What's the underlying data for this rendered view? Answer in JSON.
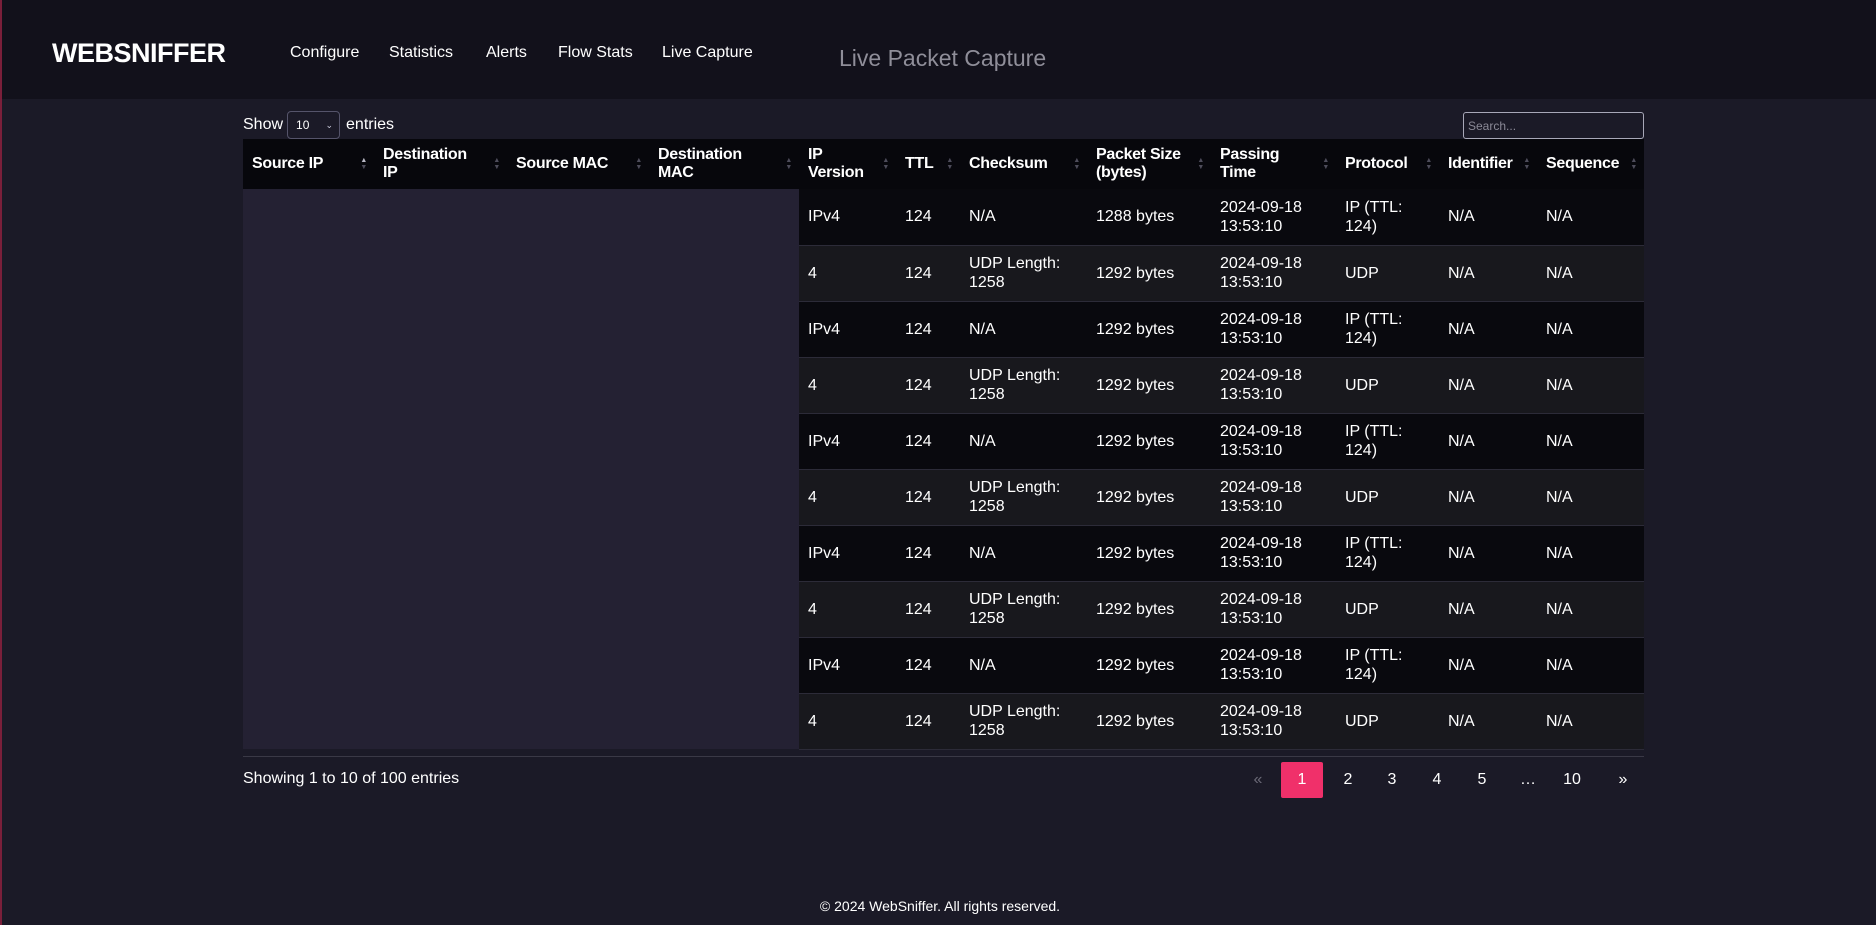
{
  "brand": "WEBSNIFFER",
  "nav": [
    "Configure",
    "Statistics",
    "Alerts",
    "Flow Stats",
    "Live Capture"
  ],
  "page_title": "Live Packet Capture",
  "length_control": {
    "show": "Show",
    "value": "10",
    "entries": "entries"
  },
  "search": {
    "placeholder": "Search..."
  },
  "table": {
    "columns": [
      "Source IP",
      "Destination IP",
      "Source MAC",
      "Destination MAC",
      "IP Version",
      "TTL",
      "Checksum",
      "Packet Size (bytes)",
      "Passing Time",
      "Protocol",
      "Identifier",
      "Sequence"
    ],
    "sorted_column": "Source IP",
    "rows": [
      {
        "ip_version": "IPv4",
        "ttl": "124",
        "checksum": "N/A",
        "size": "1288 bytes",
        "time": "2024-09-18 13:53:10",
        "protocol": "IP (TTL: 124)",
        "identifier": "N/A",
        "sequence": "N/A"
      },
      {
        "ip_version": "4",
        "ttl": "124",
        "checksum": "UDP Length: 1258",
        "size": "1292 bytes",
        "time": "2024-09-18 13:53:10",
        "protocol": "UDP",
        "identifier": "N/A",
        "sequence": "N/A"
      },
      {
        "ip_version": "IPv4",
        "ttl": "124",
        "checksum": "N/A",
        "size": "1292 bytes",
        "time": "2024-09-18 13:53:10",
        "protocol": "IP (TTL: 124)",
        "identifier": "N/A",
        "sequence": "N/A"
      },
      {
        "ip_version": "4",
        "ttl": "124",
        "checksum": "UDP Length: 1258",
        "size": "1292 bytes",
        "time": "2024-09-18 13:53:10",
        "protocol": "UDP",
        "identifier": "N/A",
        "sequence": "N/A"
      },
      {
        "ip_version": "IPv4",
        "ttl": "124",
        "checksum": "N/A",
        "size": "1292 bytes",
        "time": "2024-09-18 13:53:10",
        "protocol": "IP (TTL: 124)",
        "identifier": "N/A",
        "sequence": "N/A"
      },
      {
        "ip_version": "4",
        "ttl": "124",
        "checksum": "UDP Length: 1258",
        "size": "1292 bytes",
        "time": "2024-09-18 13:53:10",
        "protocol": "UDP",
        "identifier": "N/A",
        "sequence": "N/A"
      },
      {
        "ip_version": "IPv4",
        "ttl": "124",
        "checksum": "N/A",
        "size": "1292 bytes",
        "time": "2024-09-18 13:53:10",
        "protocol": "IP (TTL: 124)",
        "identifier": "N/A",
        "sequence": "N/A"
      },
      {
        "ip_version": "4",
        "ttl": "124",
        "checksum": "UDP Length: 1258",
        "size": "1292 bytes",
        "time": "2024-09-18 13:53:10",
        "protocol": "UDP",
        "identifier": "N/A",
        "sequence": "N/A"
      },
      {
        "ip_version": "IPv4",
        "ttl": "124",
        "checksum": "N/A",
        "size": "1292 bytes",
        "time": "2024-09-18 13:53:10",
        "protocol": "IP (TTL: 124)",
        "identifier": "N/A",
        "sequence": "N/A"
      },
      {
        "ip_version": "4",
        "ttl": "124",
        "checksum": "UDP Length: 1258",
        "size": "1292 bytes",
        "time": "2024-09-18 13:53:10",
        "protocol": "UDP",
        "identifier": "N/A",
        "sequence": "N/A"
      }
    ]
  },
  "info": "Showing 1 to 10 of 100 entries",
  "pagination": {
    "prev": "«",
    "pages": [
      "1",
      "2",
      "3",
      "4",
      "5",
      "…",
      "10"
    ],
    "next": "»",
    "current": "1"
  },
  "footer": "© 2024 WebSniffer. All rights reserved.",
  "colors": {
    "accent": "#f0306a",
    "navbar": "#12111b",
    "background": "#1b1a27",
    "masked": "#242133"
  }
}
